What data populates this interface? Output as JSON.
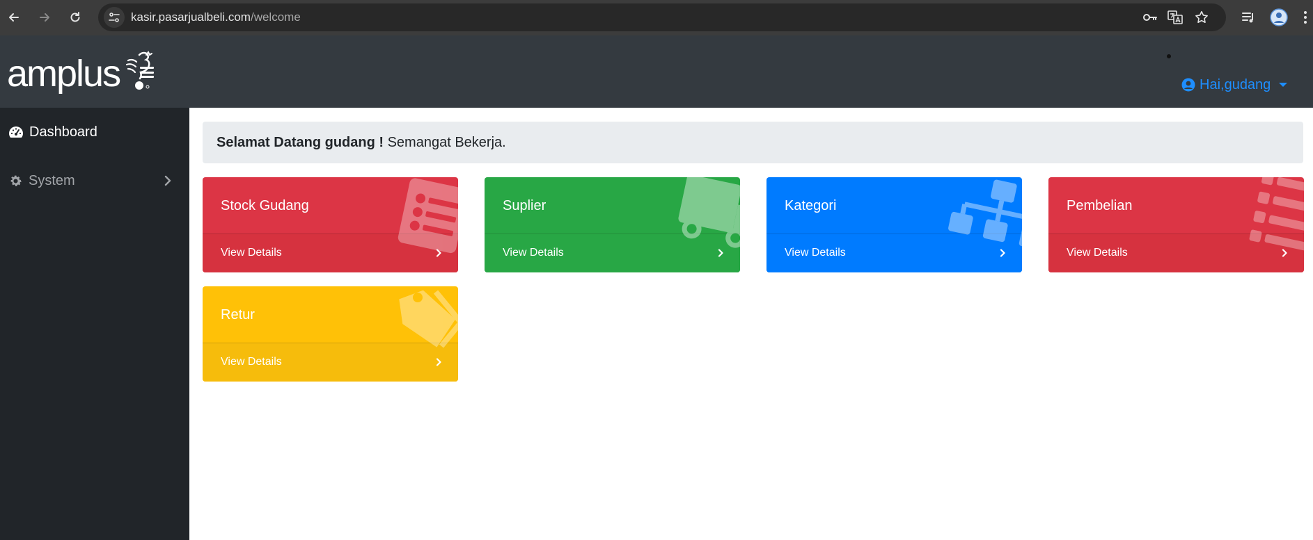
{
  "browser": {
    "url_host": "kasir.pasarjualbeli.com",
    "url_path": "/welcome",
    "icons": [
      "back-icon",
      "forward-icon",
      "reload-icon",
      "site-info-icon",
      "key-icon",
      "translate-icon",
      "star-icon",
      "media-icon",
      "profile-icon",
      "more-icon"
    ]
  },
  "navbar": {
    "logo_text": "amplus",
    "user_label": "Hai,gudang"
  },
  "sidebar": {
    "items": [
      {
        "label": "Dashboard",
        "icon": "tachometer-icon",
        "active": true
      },
      {
        "label": "System",
        "icon": "gear-icon",
        "active": false
      }
    ]
  },
  "welcome": {
    "bold": "Selamat Datang gudang !",
    "rest": " Semangat Bekerja."
  },
  "cards": [
    {
      "title": "Stock Gudang",
      "link": "View Details",
      "color": "#dc3545",
      "icon": "list-icon"
    },
    {
      "title": "Suplier",
      "link": "View Details",
      "color": "#28a745",
      "icon": "truck-icon"
    },
    {
      "title": "Kategori",
      "link": "View Details",
      "color": "#007bff",
      "icon": "sitemap-icon"
    },
    {
      "title": "Pembelian",
      "link": "View Details",
      "color": "#dc3545",
      "icon": "list-icon"
    },
    {
      "title": "Retur",
      "link": "View Details",
      "color": "#ffc107",
      "icon": "tags-icon"
    }
  ]
}
